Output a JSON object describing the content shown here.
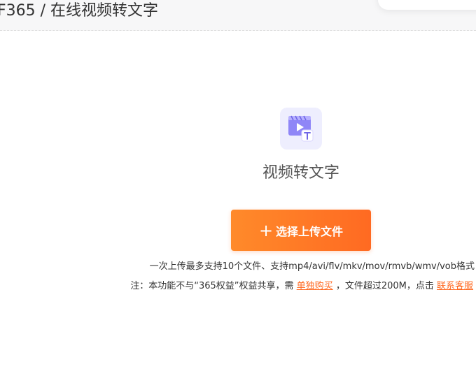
{
  "header": {
    "breadcrumb": "F365 / 在线视频转文字"
  },
  "tool": {
    "icon": "video-to-text-icon",
    "title": "视频转文字",
    "upload_label": "选择上传文件",
    "formats_text": "一次上传最多支持10个文件、支持mp4/avi/flv/mkv/mov/rmvb/wmv/vob格式",
    "note": {
      "prefix": "注：本功能不与“365权益”权益共享，需 ",
      "buy_link": "单独购买",
      "middle": " ，文件超过200M，点击 ",
      "service_link": "联系客服"
    }
  },
  "colors": {
    "accent": "#ff6a22",
    "icon_bg": "#eeeefe",
    "icon_primary": "#8f86f7"
  }
}
